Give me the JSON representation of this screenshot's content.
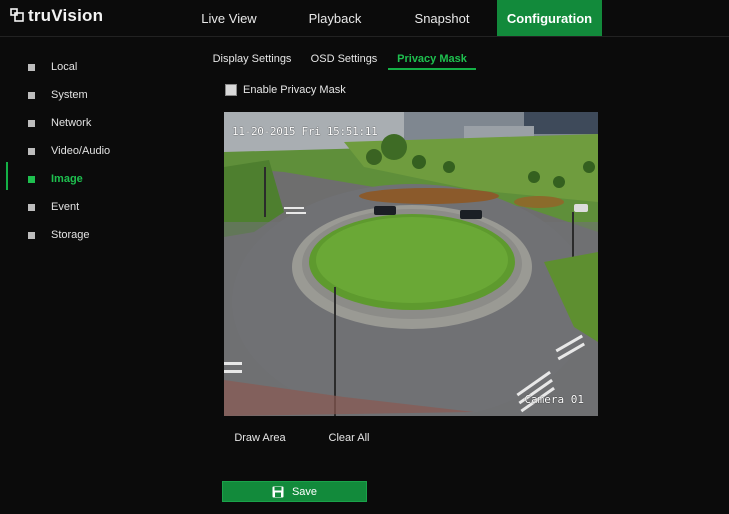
{
  "brand": {
    "name": "truVision"
  },
  "nav": {
    "tabs": [
      {
        "label": "Live View"
      },
      {
        "label": "Playback"
      },
      {
        "label": "Snapshot"
      },
      {
        "label": "Configuration",
        "active": true
      }
    ]
  },
  "sidebar": {
    "items": [
      {
        "label": "Local"
      },
      {
        "label": "System"
      },
      {
        "label": "Network"
      },
      {
        "label": "Video/Audio"
      },
      {
        "label": "Image",
        "active": true
      },
      {
        "label": "Event"
      },
      {
        "label": "Storage"
      }
    ]
  },
  "subtabs": [
    {
      "label": "Display Settings"
    },
    {
      "label": "OSD Settings"
    },
    {
      "label": "Privacy Mask",
      "active": true
    }
  ],
  "privacy": {
    "enable_label": "Enable Privacy Mask",
    "enabled": false
  },
  "camera": {
    "osd_time": "11-20-2015  Fri 15:51:11",
    "osd_name": "Camera 01"
  },
  "actions": {
    "draw_area": "Draw Area",
    "clear_all": "Clear All",
    "save": "Save"
  },
  "colors": {
    "accent": "#128a3b",
    "accent_text": "#1ec04f",
    "background": "#0b0b0b"
  },
  "icons": {
    "logo": "truvision-logo-icon",
    "save": "floppy-disk-icon",
    "bullet": "square-bullet-icon"
  }
}
